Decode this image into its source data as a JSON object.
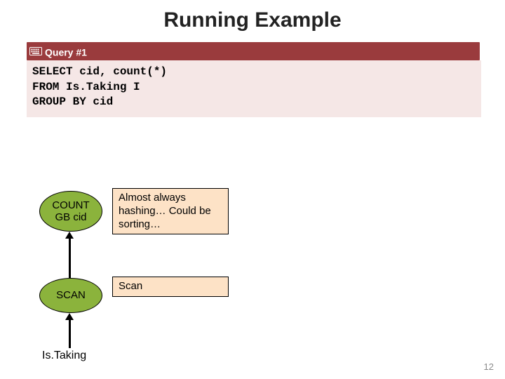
{
  "title": "Running Example",
  "query_bar": {
    "icon_name": "keyboard-icon",
    "label": "Query #1"
  },
  "sql": "SELECT cid, count(*)\nFROM Is.Taking I\nGROUP BY cid",
  "plan": {
    "count_node": "COUNT\nGB cid",
    "scan_node": "SCAN",
    "leaf_label": "Is.Taking"
  },
  "annotations": {
    "count": "Almost always hashing… Could be sorting…",
    "scan": "Scan"
  },
  "page_number": "12"
}
